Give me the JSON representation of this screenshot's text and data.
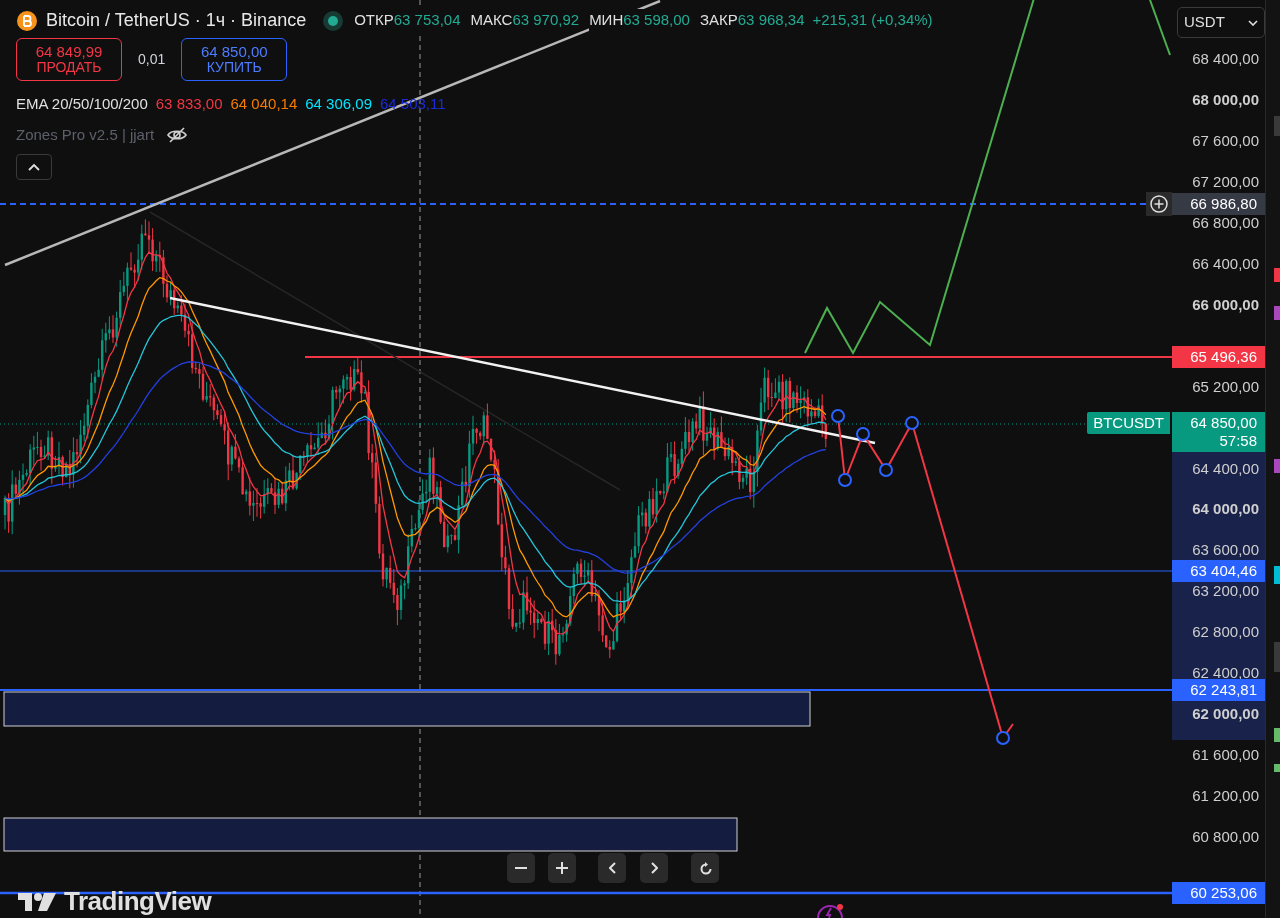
{
  "header": {
    "symbol": "Bitcoin / TetherUS · 1ч · Binance",
    "stats": [
      {
        "label": "ОТКР",
        "value": "63 753,04"
      },
      {
        "label": "МАКС",
        "value": "63 970,92"
      },
      {
        "label": "МИН",
        "value": "63 598,00"
      },
      {
        "label": "ЗАКР",
        "value": "63 968,34"
      }
    ],
    "change": "+215,31 (+0,34%)"
  },
  "trade": {
    "sell": {
      "price": "64 849,99",
      "label": "ПРОДАТЬ"
    },
    "spread": "0,01",
    "buy": {
      "price": "64 850,00",
      "label": "КУПИТЬ"
    }
  },
  "indicators": [
    {
      "name": "EMA 20/50/100/200",
      "hidden": false,
      "values": [
        {
          "text": "63 833,00",
          "color": "#f23645"
        },
        {
          "text": "64 040,14",
          "color": "#f57c00"
        },
        {
          "text": "64 306,09",
          "color": "#00e5ff"
        },
        {
          "text": "64 503,11",
          "color": "#1a2bd8"
        }
      ]
    },
    {
      "name": "Zones Pro v2.5 | jjart",
      "hidden": true
    }
  ],
  "currency": "USDT",
  "price_axis": {
    "ticks": [
      {
        "text": "68 400,00",
        "major": false
      },
      {
        "text": "68 000,00",
        "major": true
      },
      {
        "text": "67 600,00",
        "major": false
      },
      {
        "text": "67 200,00",
        "major": false
      },
      {
        "text": "66 800,00",
        "major": false
      },
      {
        "text": "66 400,00",
        "major": false
      },
      {
        "text": "66 000,00",
        "major": true
      },
      {
        "text": "65 200,00",
        "major": false
      },
      {
        "text": "64 400,00",
        "major": false
      },
      {
        "text": "64 000,00",
        "major": true
      },
      {
        "text": "63 600,00",
        "major": false
      },
      {
        "text": "63 200,00",
        "major": false
      },
      {
        "text": "62 800,00",
        "major": false
      },
      {
        "text": "62 400,00",
        "major": false
      },
      {
        "text": "62 000,00",
        "major": true
      },
      {
        "text": "61 600,00",
        "major": false
      },
      {
        "text": "61 200,00",
        "major": false
      },
      {
        "text": "60 800,00",
        "major": false
      }
    ],
    "tags": [
      {
        "text": "66 986,80",
        "color": "#363a45"
      },
      {
        "text": "65 496,36",
        "color": "#f23645"
      },
      {
        "text": "63 404,46",
        "color": "#2962ff"
      },
      {
        "text": "62 243,81",
        "color": "#2962ff"
      },
      {
        "text": "60 253,06",
        "color": "#2962ff"
      }
    ],
    "symbol_tag": "BTCUSDT",
    "last_price": "64 850,00",
    "countdown": "57:58"
  },
  "logo": "TradingView"
}
